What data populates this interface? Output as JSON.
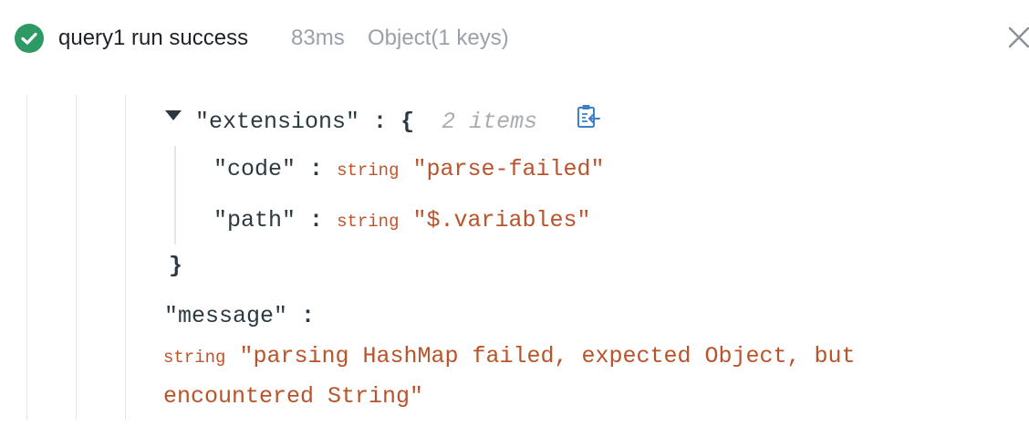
{
  "header": {
    "status_icon": "check-circle-icon",
    "status_color": "#2e9a63",
    "title": "query1 run success",
    "duration": "83ms",
    "result_type": "Object(1 keys)",
    "close_icon": "close-icon"
  },
  "tree": {
    "extensions": {
      "key": "\"extensions\"",
      "separator": ":",
      "open_brace": "{",
      "count": "2 items",
      "expanded": true,
      "copy_icon": "clipboard-copy-icon",
      "entries": [
        {
          "key": "\"code\"",
          "separator": ":",
          "type": "string",
          "value": "\"parse-failed\""
        },
        {
          "key": "\"path\"",
          "separator": ":",
          "type": "string",
          "value": "\"$.variables\""
        }
      ],
      "close_brace": "}"
    },
    "message": {
      "key": "\"message\"",
      "separator": ":",
      "type": "string",
      "value_line1": "\"parsing HashMap failed, expected Object, but",
      "value_line2": "encountered String\""
    }
  }
}
